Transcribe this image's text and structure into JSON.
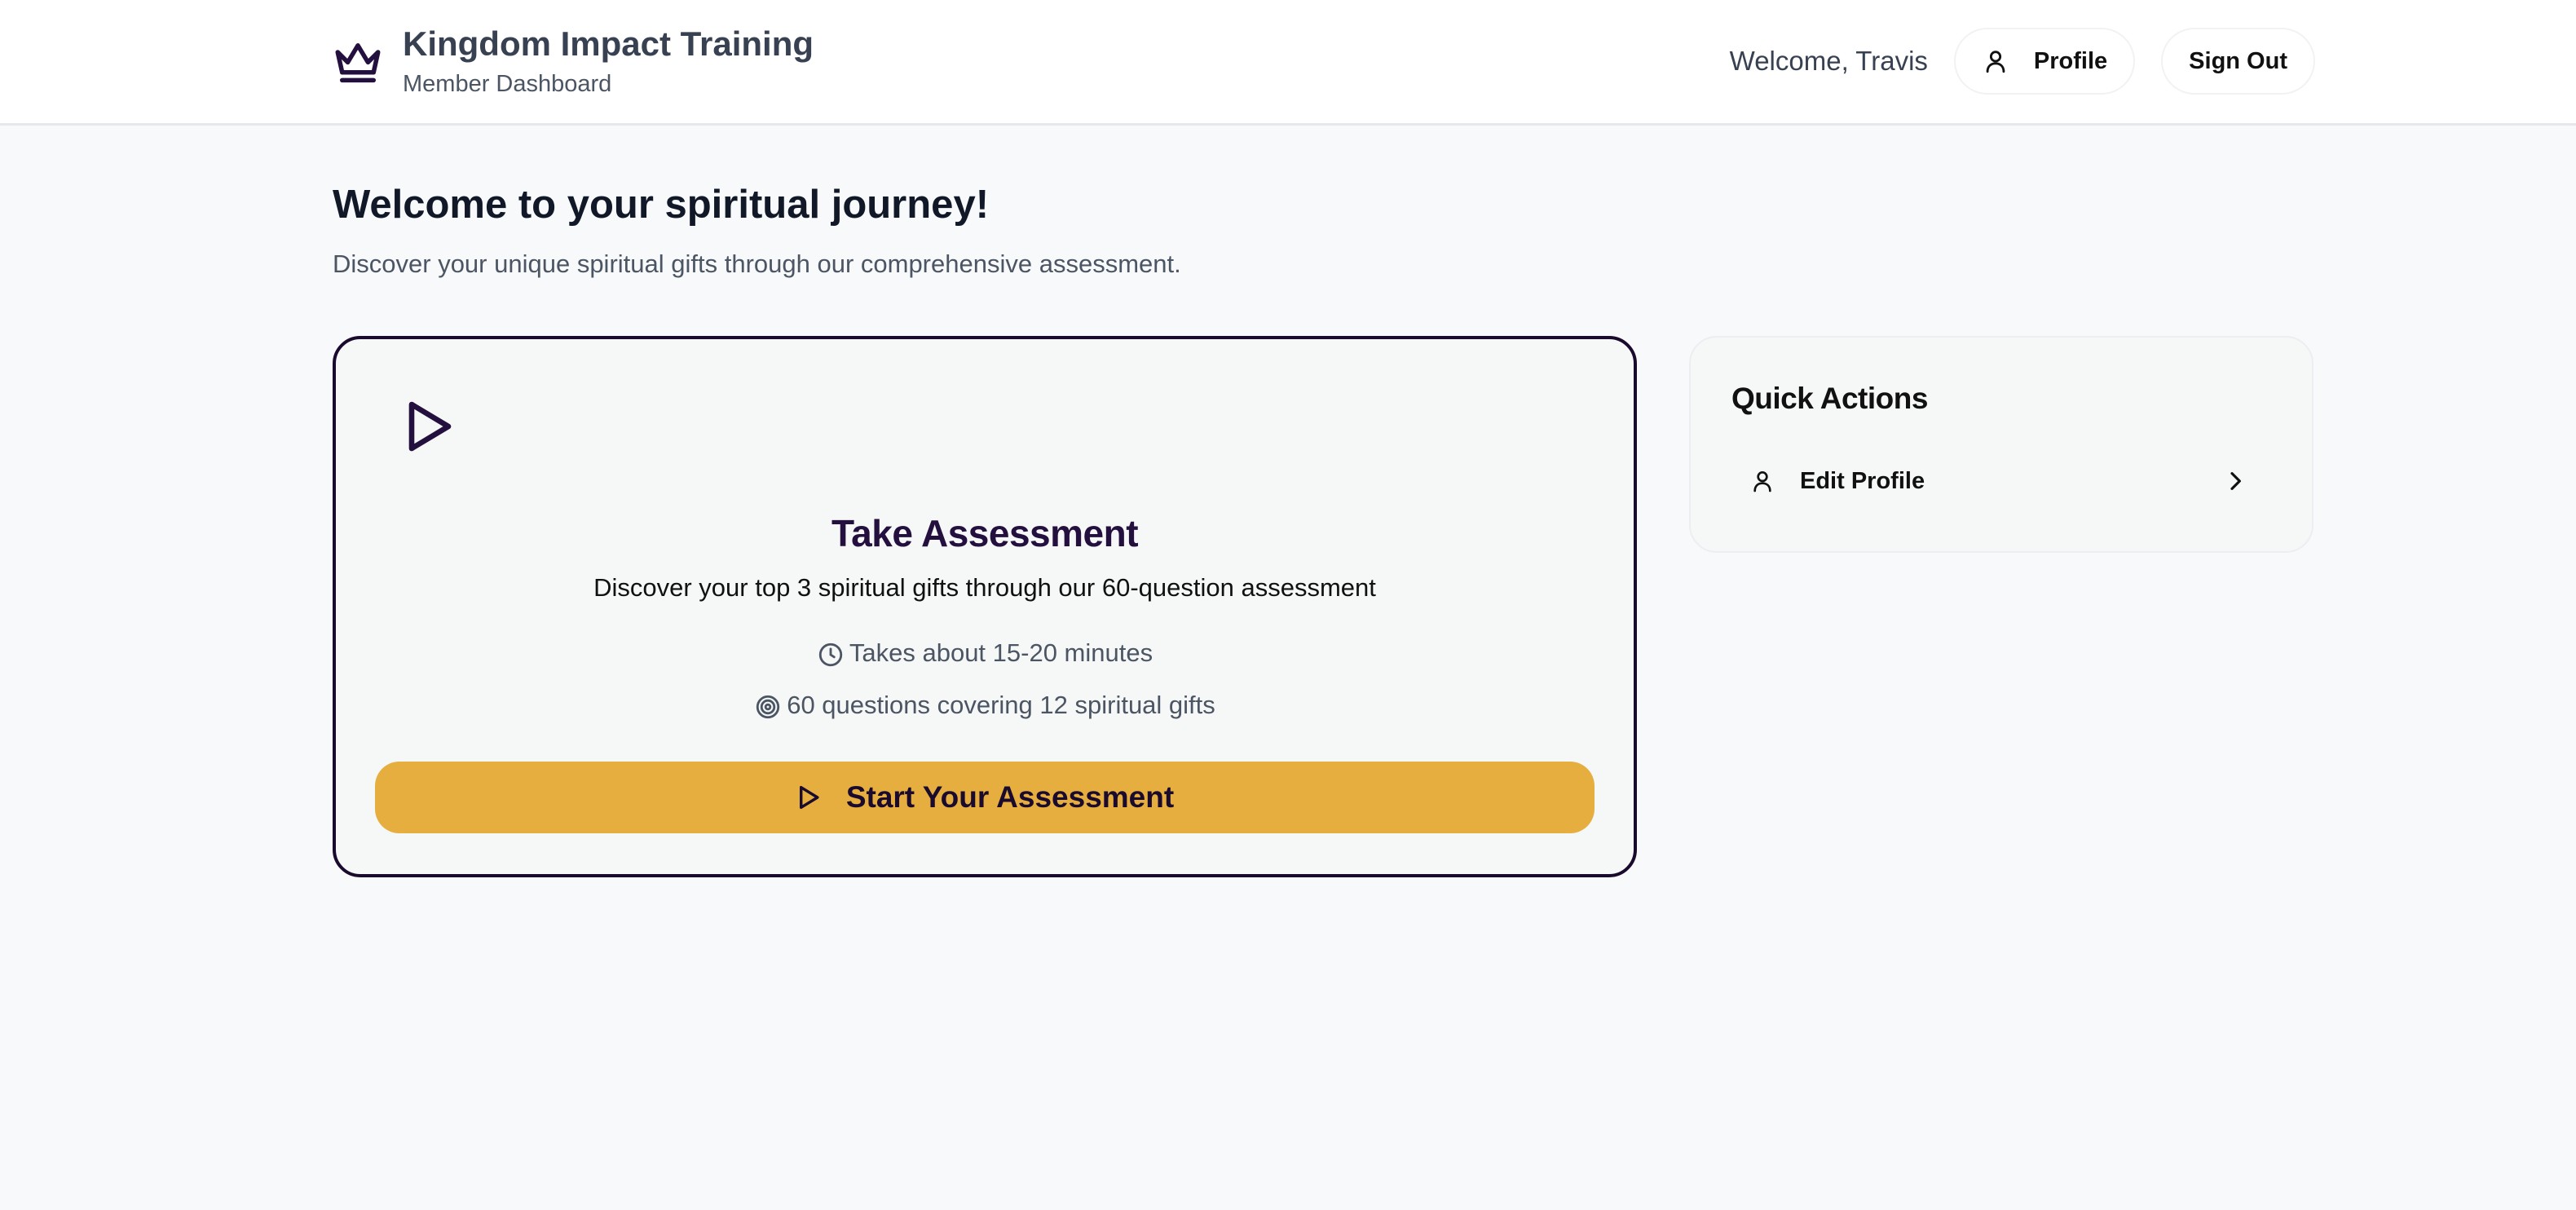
{
  "header": {
    "brand_title": "Kingdom Impact Training",
    "brand_subtitle": "Member Dashboard",
    "brand_icon": "crown-icon",
    "welcome_text": "Welcome, Travis",
    "profile_label": "Profile",
    "sign_out_label": "Sign Out"
  },
  "main": {
    "title": "Welcome to your spiritual journey!",
    "subtitle": "Discover your unique spiritual gifts through our comprehensive assessment."
  },
  "assessment_card": {
    "icon": "play-icon",
    "title": "Take Assessment",
    "description": "Discover your top 3 spiritual gifts through our 60-question assessment",
    "duration": "Takes about 15-20 minutes",
    "questions": "60 questions covering 12 spiritual gifts",
    "button_label": "Start Your Assessment"
  },
  "quick_actions": {
    "title": "Quick Actions",
    "items": [
      {
        "label": "Edit Profile",
        "icon": "user-icon"
      }
    ]
  },
  "colors": {
    "accent": "#e5ae3e",
    "brand_dark": "#1a0b2e",
    "card_title": "#24103f",
    "background": "#f8f9fa"
  }
}
